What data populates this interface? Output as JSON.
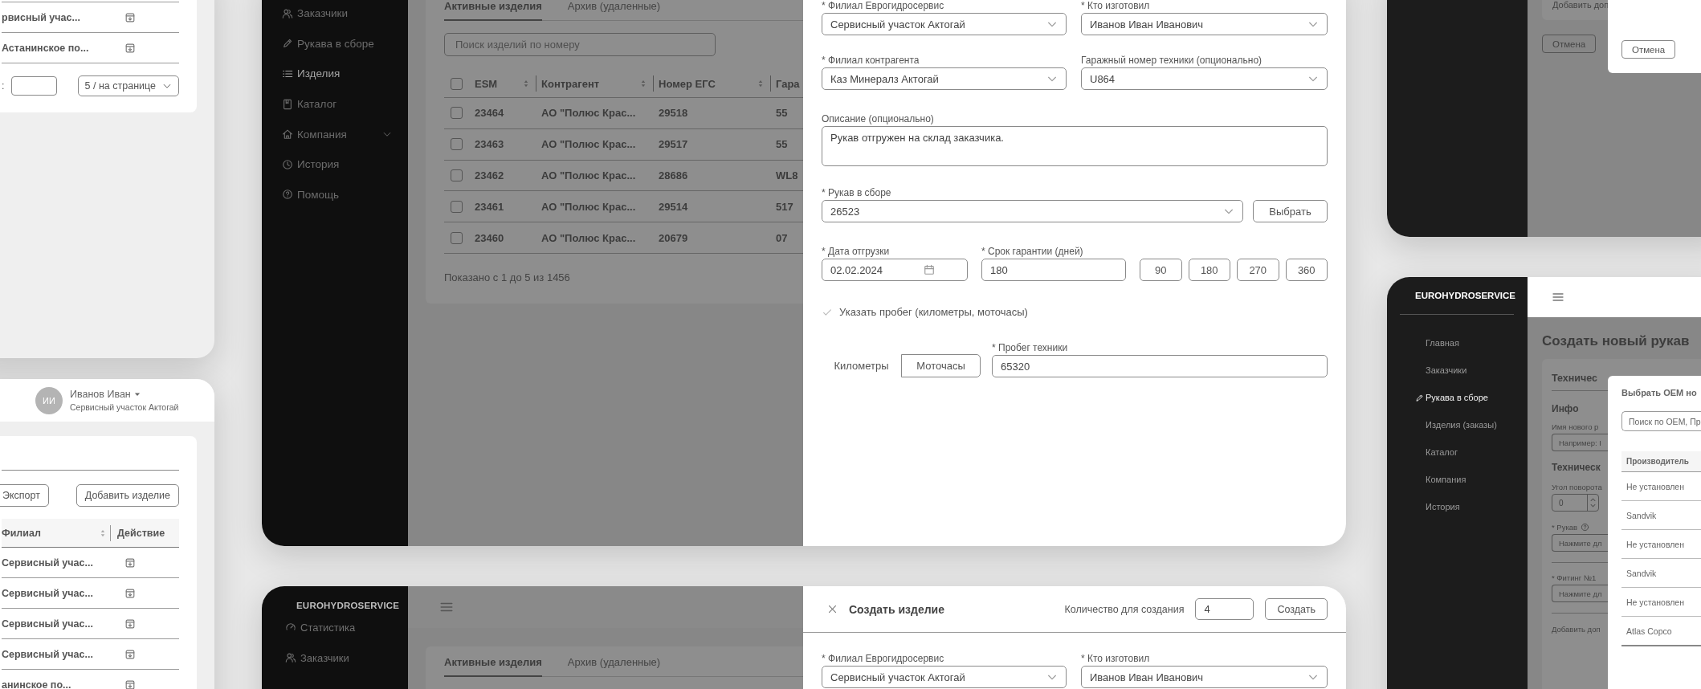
{
  "customers_card": {
    "rows": [
      {
        "branch": "рвисный учас..."
      },
      {
        "branch": "Астанинское по..."
      }
    ],
    "pagination": {
      "jump_label": ":",
      "page_size": "5 / на странице"
    }
  },
  "products_card": {
    "user": {
      "initials": "ИИ",
      "name": "Иванов Иван",
      "branch": "Сервисный участок Актогай"
    },
    "buttons": [
      "Экспорт",
      "Добавить изделие"
    ],
    "columns": [
      "Филиал",
      "Действие"
    ],
    "rows": [
      {
        "branch": "Сервисный учас..."
      },
      {
        "branch": "Сервисный учас..."
      },
      {
        "branch": "Сервисный учас..."
      },
      {
        "branch": "Сервисный учас..."
      },
      {
        "branch": "анинское по..."
      }
    ]
  },
  "products_screen": {
    "sidebar": {
      "items": [
        {
          "label": "Заказчики",
          "selected": false,
          "kind": "link"
        },
        {
          "label": "Рукава в сборе",
          "selected": false,
          "kind": "link"
        },
        {
          "label": "Изделия",
          "selected": true,
          "kind": "link"
        },
        {
          "label": "Каталог",
          "selected": false,
          "kind": "link"
        },
        {
          "label": "Компания",
          "selected": false,
          "kind": "group"
        },
        {
          "label": "История",
          "selected": false,
          "kind": "link"
        },
        {
          "label": "Помощь",
          "selected": false,
          "kind": "link"
        }
      ]
    },
    "tabs": [
      {
        "label": "Активные изделия",
        "selected": true
      },
      {
        "label": "Архив (удаленные)",
        "selected": false
      }
    ],
    "search": {
      "placeholder": "Поиск изделий по номеру"
    },
    "table": {
      "header_checked": false,
      "columns": [
        "ESM",
        "Контрагент",
        "Номер ЕГС",
        "Гара"
      ],
      "rows": [
        {
          "checked": false,
          "cells": [
            "23464",
            "АО \"Полюс Крас...",
            "29518",
            "55"
          ]
        },
        {
          "checked": false,
          "cells": [
            "23463",
            "АО \"Полюс Крас...",
            "29517",
            "55"
          ]
        },
        {
          "checked": false,
          "cells": [
            "23462",
            "АО \"Полюс Крас...",
            "28686",
            "WL8"
          ]
        },
        {
          "checked": false,
          "cells": [
            "23461",
            "АО \"Полюс Крас...",
            "29514",
            "517"
          ]
        },
        {
          "checked": false,
          "cells": [
            "23460",
            "АО \"Полюс Крас...",
            "20679",
            "07"
          ]
        }
      ]
    },
    "footer": "Показано с 1 до 5 из 1456",
    "form": {
      "branch": {
        "label": "* Филиал Еврогидросервис",
        "value": "Сервисный участок Актогай"
      },
      "maker": {
        "label": "* Кто изготовил",
        "value": "Иванов Иван Иванович"
      },
      "counterparty_branch": {
        "label": "* Филиал контрагента",
        "value": "Каз Минералз Актогай"
      },
      "garage_number": {
        "label": "Гаражный номер техники (опционально)",
        "value": "U864"
      },
      "description": {
        "label": "Описание (опционально)",
        "value": "Рукав отгружен на склад заказчика."
      },
      "hose_assembly": {
        "label": "* Рукав в сборе",
        "value": "26523",
        "button": "Выбрать"
      },
      "ship_date": {
        "label": "* Дата отгрузки",
        "value": "02.02.2024"
      },
      "warranty": {
        "label": "* Срок гарантии (дней)",
        "value": "180",
        "presets": [
          "90",
          "180",
          "270",
          "360"
        ]
      },
      "mileage_toggle": {
        "label": "Указать пробег (километры, моточасы)",
        "checked": true
      },
      "mileage_units": [
        {
          "label": "Километры",
          "selected": false
        },
        {
          "label": "Моточасы",
          "selected": true
        }
      ],
      "mileage": {
        "label": "* Пробег техники",
        "value": "65320"
      }
    }
  },
  "create_screen": {
    "brand": "EUROHYDROSERVICE",
    "sidebar": {
      "items": [
        {
          "label": "Статистика"
        },
        {
          "label": "Заказчики"
        }
      ]
    },
    "tabs": [
      {
        "label": "Активные изделия",
        "selected": true
      },
      {
        "label": "Архив (удаленные)",
        "selected": false
      }
    ],
    "drawer": {
      "title": "Создать изделие",
      "quantity_label": "Количество для создания",
      "quantity": "4",
      "submit": "Создать",
      "fields": [
        {
          "label": "* Филиал Еврогидросервис",
          "value": "Сервисный участок Актогай"
        },
        {
          "label": "* Кто изготовил",
          "value": "Иванов Иван Иванович"
        }
      ]
    }
  },
  "hose_modal_screen": {
    "panel_link": "Добавить доп",
    "cancel": "Отмена",
    "modal": {
      "cancel": "Отмена"
    }
  },
  "create_hose_screen": {
    "brand": "EUROHYDROSERVICE",
    "sidebar": {
      "items": [
        {
          "label": "Главная",
          "selected": false
        },
        {
          "label": "Заказчики",
          "selected": false
        },
        {
          "label": "Рукава в сборе",
          "selected": true
        },
        {
          "label": "Изделия (заказы)",
          "selected": false
        },
        {
          "label": "Каталог",
          "selected": false
        },
        {
          "label": "Компания",
          "selected": false
        },
        {
          "label": "История",
          "selected": false
        }
      ]
    },
    "title": "Создать новый рукав",
    "panel": {
      "heading": "Техничес",
      "info": "Инфо",
      "name_label": "Имя нового р",
      "name_placeholder": "Например: I",
      "tech_heading": "Техническ",
      "angle_label": "Угол поворота",
      "angle": "0",
      "hose_label": "* Рукав",
      "hose_placeholder": "Нажмите дл",
      "fitting_label": "* Фитинг №1",
      "fitting_placeholder": "Нажмите дл",
      "add_link": "Добавить доп"
    },
    "modal": {
      "title": "Выбрать OEM но",
      "search": {
        "placeholder": "Поиск по OEM, Пр"
      },
      "columns": [
        "Производитель"
      ],
      "rows": [
        [
          "Не установлен"
        ],
        [
          "Sandvik"
        ],
        [
          "Не установлен"
        ],
        [
          "Sandvik"
        ],
        [
          "Не установлен"
        ],
        [
          "Atlas Copco"
        ]
      ]
    }
  }
}
